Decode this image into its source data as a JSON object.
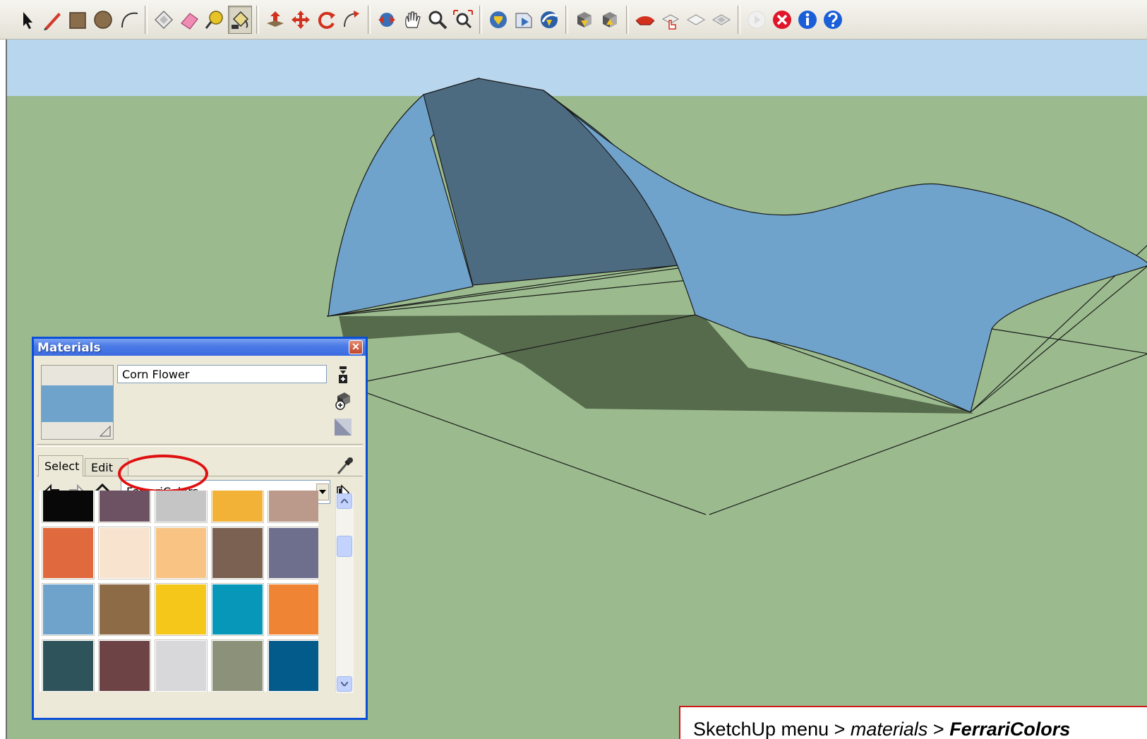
{
  "toolbar": {
    "groups": [
      [
        "select-arrow-icon",
        "pencil-line-icon",
        "rectangle-icon",
        "circle-icon",
        "arc-icon"
      ],
      [
        "make-component-icon",
        "eraser-icon",
        "tape-measure-icon",
        "paint-bucket-icon"
      ],
      [
        "push-pull-icon",
        "move-icon",
        "rotate-icon",
        "follow-me-icon"
      ],
      [
        "orbit-icon",
        "pan-icon",
        "zoom-icon",
        "zoom-extents-icon"
      ],
      [
        "get-models-icon",
        "share-model-icon",
        "google-earth-icon"
      ],
      [
        "get-component-icon",
        "share-component-icon"
      ],
      [
        "sandbox-red-icon",
        "sandbox-hand-icon",
        "sandbox-stamp-icon",
        "sandbox-drape-icon"
      ],
      [
        "play-disabled-icon",
        "close-red-icon",
        "info-icon",
        "help-icon"
      ]
    ],
    "active": "paint-bucket-icon"
  },
  "materials_dialog": {
    "title": "Materials",
    "close_glyph": "✕",
    "material_name": "Corn Flower",
    "preview_color": "#6fa3cb",
    "tabs": [
      {
        "label": "Select",
        "active": true
      },
      {
        "label": "Edit",
        "active": false
      }
    ],
    "collection": "FerrariColors",
    "swatches": [
      [
        "#080808",
        "#6d5263",
        "#c5c5c5",
        "#f1b237",
        "#bb998b"
      ],
      [
        "#e06a3d",
        "#f8e3cf",
        "#f9c384",
        "#7a6151",
        "#6d6f8c"
      ],
      [
        "#6fa3cb",
        "#8d6b46",
        "#f4c71a",
        "#0797b9",
        "#ef8534"
      ],
      [
        "#2e535b",
        "#6d4345",
        "#d8d8da",
        "#8c917a",
        "#035b8c"
      ]
    ]
  },
  "scene": {
    "sky_color": "#b9d6ef",
    "ground_color": "#9bbb8e",
    "surface_light": "#6fa3cb",
    "surface_dark": "#4d6b80",
    "shadow_color": "#566a4c"
  },
  "caption": {
    "prefix": "SketchUp menu > ",
    "middle": "materials",
    "separator": " > ",
    "suffix": "FerrariColors"
  }
}
